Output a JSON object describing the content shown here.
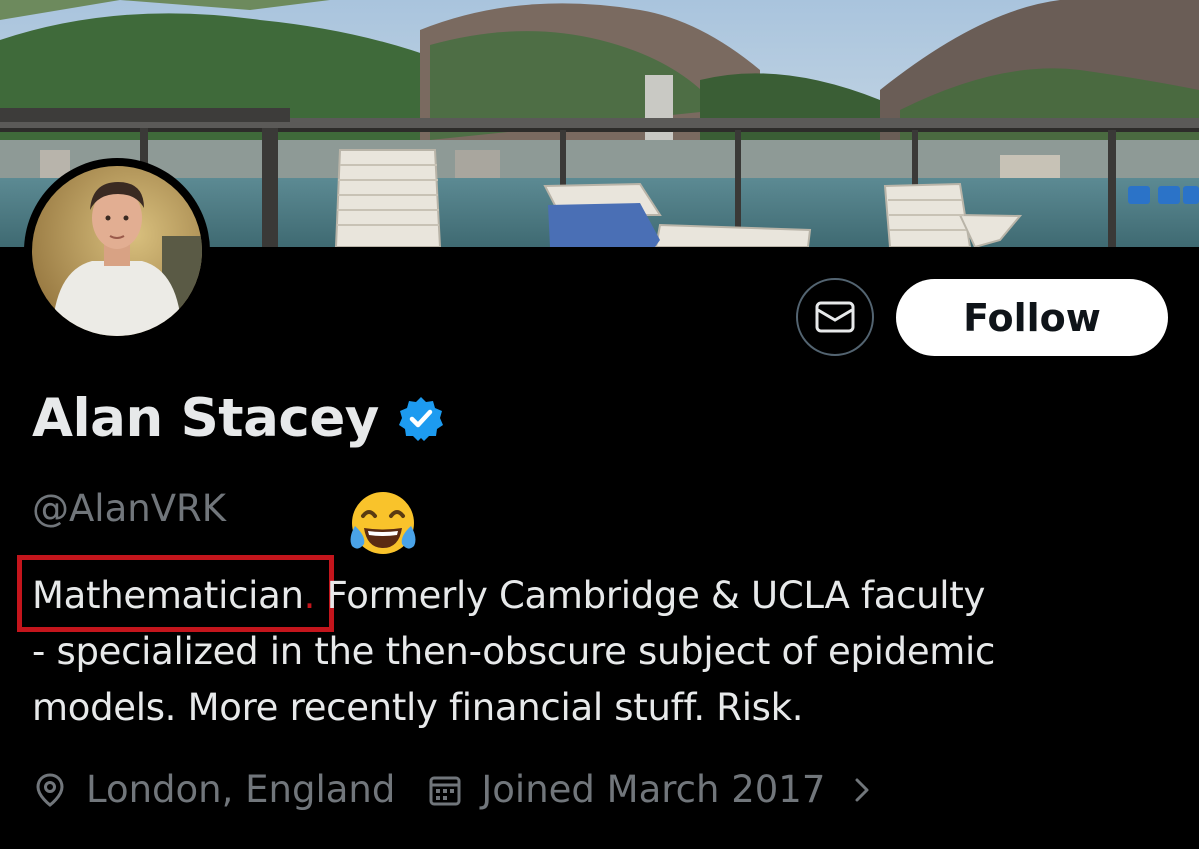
{
  "profile": {
    "name": "Alan Stacey",
    "handle": "@AlanVRK",
    "bio_lines": [
      {
        "highlighted": "Mathematician",
        "dot": ".",
        "rest": " Formerly Cambridge & UCLA faculty"
      },
      "- specialized in the then-obscure subject of epidemic",
      "models. More recently financial stuff. Risk."
    ],
    "location": "London, England",
    "joined": "Joined March 2017"
  },
  "actions": {
    "follow_label": "Follow"
  },
  "icons": {
    "message": "envelope-icon",
    "verified": "verified-badge-icon",
    "location": "location-pin-icon",
    "calendar": "calendar-icon",
    "chevron": "chevron-right-icon",
    "emoji": "tears-of-joy-emoji"
  },
  "colors": {
    "background": "#000000",
    "text_primary": "#e7e9ea",
    "text_secondary": "#71767b",
    "verified_blue": "#1d9bf0",
    "highlight_red": "#c4151c",
    "follow_bg": "#ffffff"
  }
}
